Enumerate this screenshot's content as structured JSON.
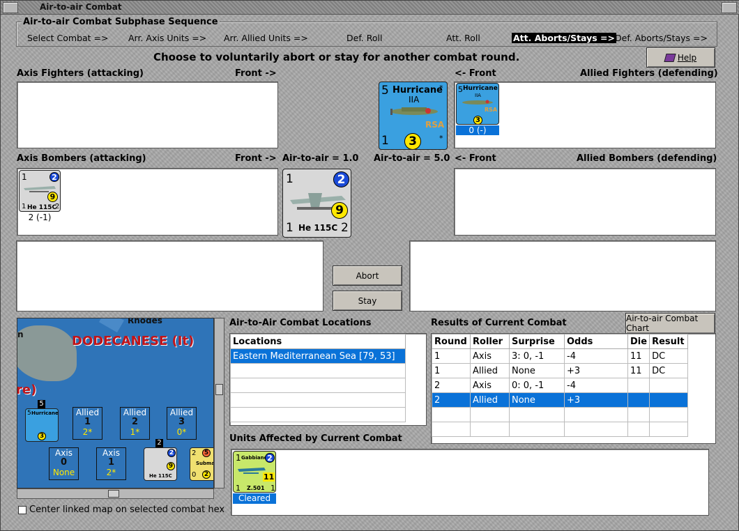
{
  "window": {
    "title": "Air-to-air Combat"
  },
  "sequence": {
    "title": "Air-to-air Combat Subphase Sequence",
    "steps": [
      "Select Combat =>",
      "Arr. Axis Units =>",
      "Arr. Allied Units =>",
      "Def. Roll",
      "Att. Roll",
      "Att. Aborts/Stays =>",
      "Def. Aborts/Stays =>"
    ],
    "active_index": 5
  },
  "prompt": "Choose to voluntarily abort or stay for another combat round.",
  "help_label": "Help",
  "labels": {
    "axis_fighters": "Axis Fighters (attacking)",
    "front_right1": "Front ->",
    "front_left1": "<- Front",
    "allied_fighters": "Allied Fighters (defending)",
    "axis_bombers": "Axis Bombers (attacking)",
    "front_right2": "Front ->",
    "air_to_air_axis": "Air-to-air = 1.0",
    "air_to_air_allied": "Air-to-air = 5.0",
    "front_left2": "<- Front",
    "allied_bombers": "Allied Bombers (defending)"
  },
  "units": {
    "hurricane": {
      "name": "Hurricane",
      "sub": "IIA",
      "nation": "RSA",
      "top": "5",
      "bottom": "1",
      "value": "3",
      "star": "*",
      "status": "0 (-)"
    },
    "he115": {
      "name": "He 115C",
      "top": "1",
      "top_right": "2",
      "value": "9",
      "bottom": "1",
      "bottom_right": "2",
      "status": "2 (-1)"
    },
    "gabbiano": {
      "name": "Gabbiano",
      "model": "Z.501",
      "top": "1",
      "top_right": "2",
      "value": "11",
      "bottom": "1",
      "bottom_right": "1",
      "status": "Cleared"
    }
  },
  "buttons": {
    "abort": "Abort",
    "stay": "Stay",
    "chart": "Air-to-air Combat Chart"
  },
  "map": {
    "region_label": "DODECANESE (It)",
    "place_label": "Rhodes",
    "partial_left": "n",
    "partial_mid": "re)",
    "stack_counts": {
      "fighter": "5",
      "bomber": "2"
    },
    "sub_label": "Submar",
    "sub_vals": {
      "tl": "2",
      "tr": "5",
      "bl": "0",
      "br": "2"
    },
    "boxes": [
      {
        "side": "Allied",
        "num": "1",
        "val": "2*"
      },
      {
        "side": "Allied",
        "num": "2",
        "val": "1*"
      },
      {
        "side": "Allied",
        "num": "3",
        "val": "0*"
      },
      {
        "side": "Axis",
        "num": "0",
        "val": "None"
      },
      {
        "side": "Axis",
        "num": "1",
        "val": "2*"
      }
    ]
  },
  "center_linked_label": "Center linked map on selected combat hex",
  "locations": {
    "title": "Air-to-Air Combat Locations",
    "header": "Locations",
    "rows": [
      "Eastern Mediterranean Sea [79, 53]"
    ]
  },
  "results": {
    "title": "Results of Current Combat",
    "headers": [
      "Round",
      "Roller",
      "Surprise",
      "Odds",
      "Die",
      "Result"
    ],
    "rows": [
      [
        "1",
        "Axis",
        "3: 0, -1",
        "-4",
        "11",
        "DC"
      ],
      [
        "1",
        "Allied",
        "None",
        "+3",
        "11",
        "DC"
      ],
      [
        "2",
        "Axis",
        "0: 0, -1",
        "-4",
        "",
        ""
      ],
      [
        "2",
        "Allied",
        "None",
        "+3",
        "",
        ""
      ]
    ],
    "selected_row": 3
  },
  "affected_title": "Units Affected by Current Combat",
  "colors": {
    "selection": "#0a72d8",
    "counter_blue": "#3aa0e0",
    "map_sea": "#2f74b8",
    "region_red": "#c0141a"
  }
}
